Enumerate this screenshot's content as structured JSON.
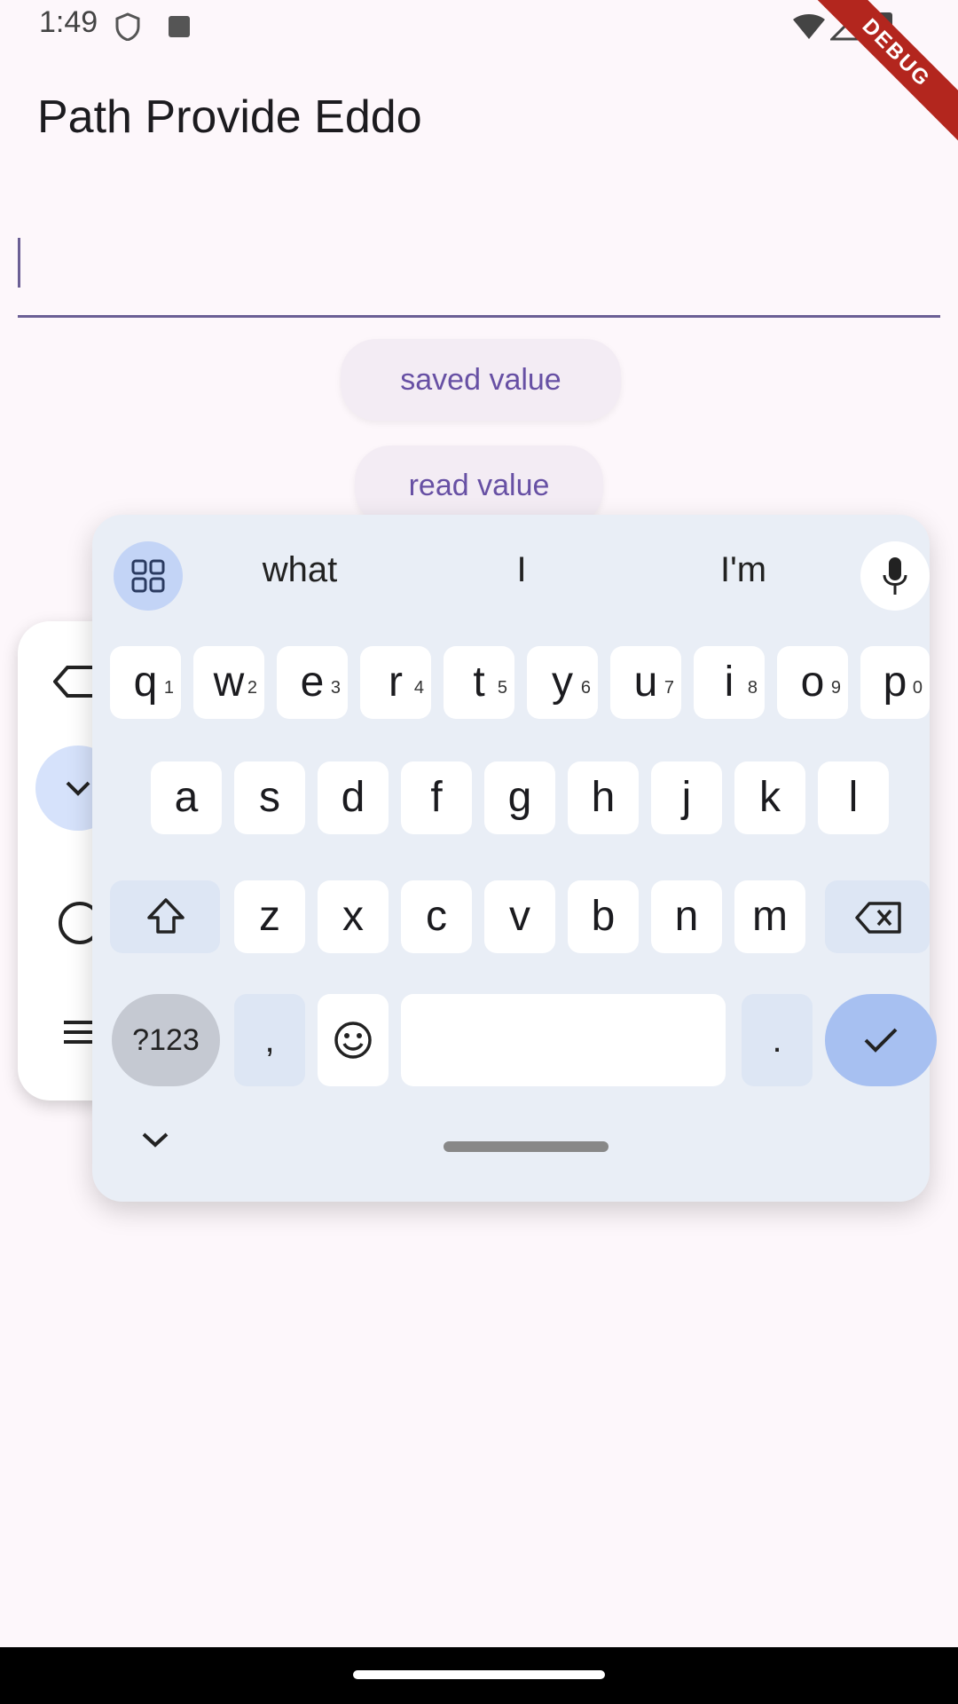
{
  "status_bar": {
    "time": "1:49"
  },
  "debug_banner": "DEBUG",
  "app_bar": {
    "title": "Path Provide Eddo"
  },
  "text_field": {
    "value": ""
  },
  "buttons": {
    "saved": "saved value",
    "read": "read value"
  },
  "keyboard": {
    "suggestions": [
      "what",
      "I",
      "I'm"
    ],
    "row1": [
      {
        "k": "q",
        "n": "1"
      },
      {
        "k": "w",
        "n": "2"
      },
      {
        "k": "e",
        "n": "3"
      },
      {
        "k": "r",
        "n": "4"
      },
      {
        "k": "t",
        "n": "5"
      },
      {
        "k": "y",
        "n": "6"
      },
      {
        "k": "u",
        "n": "7"
      },
      {
        "k": "i",
        "n": "8"
      },
      {
        "k": "o",
        "n": "9"
      },
      {
        "k": "p",
        "n": "0"
      }
    ],
    "row2": [
      "a",
      "s",
      "d",
      "f",
      "g",
      "h",
      "j",
      "k",
      "l"
    ],
    "row3": [
      "z",
      "x",
      "c",
      "v",
      "b",
      "n",
      "m"
    ],
    "symbols_label": "?123",
    "comma": ",",
    "period": "."
  }
}
